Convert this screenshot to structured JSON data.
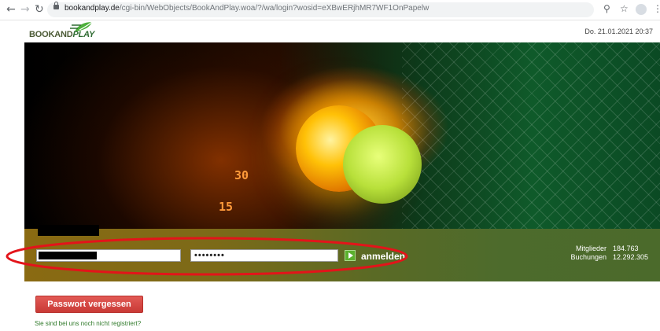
{
  "browser": {
    "url_host": "bookandplay.de",
    "url_path": "/cgi-bin/WebObjects/BookAndPlay.woa/?/wa/login?wosid=eXBwERjhMR7WF1OnPapelw",
    "icons": [
      "back-icon",
      "forward-icon",
      "reload-icon",
      "lock-icon",
      "zoom-icon",
      "star-icon",
      "profile-icon",
      "menu-icon"
    ]
  },
  "header": {
    "logo_prefix": "BOOKAND",
    "logo_suffix": "PLAY",
    "datetime": "Do. 21.01.2021 20:37"
  },
  "banner": {
    "score_30": "30",
    "score_15": "15"
  },
  "login": {
    "password_value": "••••••••",
    "submit_label": "anmelden"
  },
  "stats": {
    "members_label": "Mitglieder",
    "members_value": "184.763",
    "bookings_label": "Buchungen",
    "bookings_value": "12.292.305"
  },
  "actions": {
    "forgot_password_label": "Passwort vergessen",
    "register_link": "Sie sind bei uns noch nicht registriert?"
  },
  "colors": {
    "brand_green": "#2f6b32",
    "button_red": "#c93a36",
    "annotation_red": "#e3141a"
  }
}
